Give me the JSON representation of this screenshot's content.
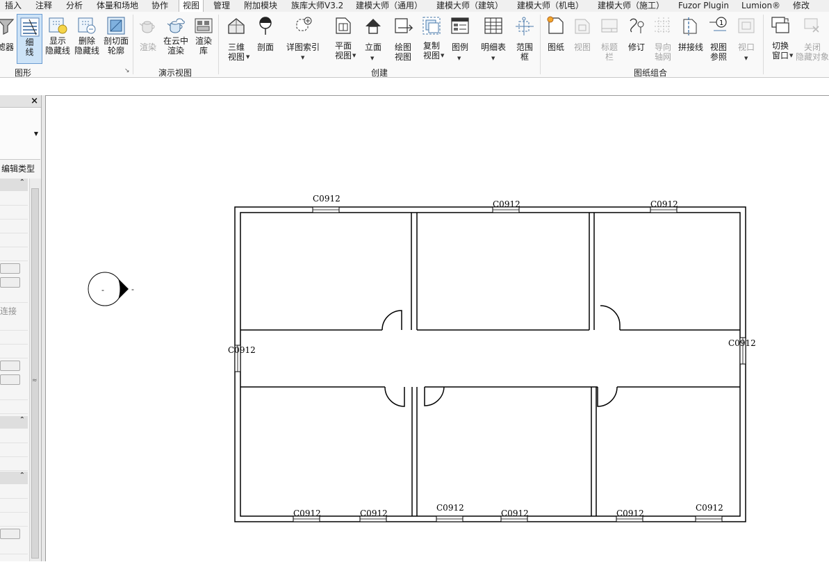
{
  "tabs": [
    "插入",
    "注释",
    "分析",
    "体量和场地",
    "协作",
    "视图",
    "管理",
    "附加模块",
    "族库大师V3.2",
    "建模大师（通用）",
    "建模大师（建筑）",
    "建模大师（机电）",
    "建模大师（施工）",
    "Fuzor Plugin",
    "Lumion®",
    "修改"
  ],
  "active_tab": "视图",
  "ribbon": {
    "graphics": {
      "title": "图形",
      "filter": "滤器",
      "thin_lines": [
        "细",
        "线"
      ],
      "show_hidden": [
        "显示",
        "隐藏线"
      ],
      "remove_hidden": [
        "删除",
        "隐藏线"
      ],
      "cut_profile": [
        "剖切面",
        "轮廓"
      ]
    },
    "presentation": {
      "title": "演示视图",
      "render": "渲染",
      "cloud_render": [
        "在云中",
        "渲染"
      ],
      "render_gallery": [
        "渲染",
        "库"
      ]
    },
    "create": {
      "title": "创建",
      "three_d": [
        "三维",
        "视图"
      ],
      "section": "剖面",
      "callout": "详图索引",
      "plan": [
        "平面",
        "视图"
      ],
      "elevation": "立面",
      "drafting": [
        "绘图",
        "视图"
      ],
      "duplicate": [
        "复制",
        "视图"
      ],
      "legend": "图例",
      "schedule": "明细表",
      "scope_box": [
        "范围",
        "框"
      ]
    },
    "sheet": {
      "title": "图纸组合",
      "sheet": "图纸",
      "view": "视图",
      "title_block": [
        "标题",
        "栏"
      ],
      "revision": "修订",
      "guide_grid": [
        "导向",
        "轴网"
      ],
      "matchline": "拼接线",
      "view_reference": [
        "视图",
        "参照"
      ],
      "viewport": "视口"
    },
    "windows": {
      "switch": [
        "切换",
        "窗口"
      ],
      "close_hidden": [
        "关闭",
        "隐藏对象"
      ]
    }
  },
  "properties": {
    "close": "×",
    "edit_type": "编辑类型",
    "join_text": "连接",
    "collapse": "≈"
  },
  "drawing": {
    "window_tag": "C0912",
    "elevation_marker": "-",
    "elevation_tick": "-"
  },
  "colors": {
    "tab_active_bg": "#ffffff",
    "selected_tool": "#cde3f7",
    "selected_border": "#6a9bd1",
    "wall": "#000000"
  }
}
